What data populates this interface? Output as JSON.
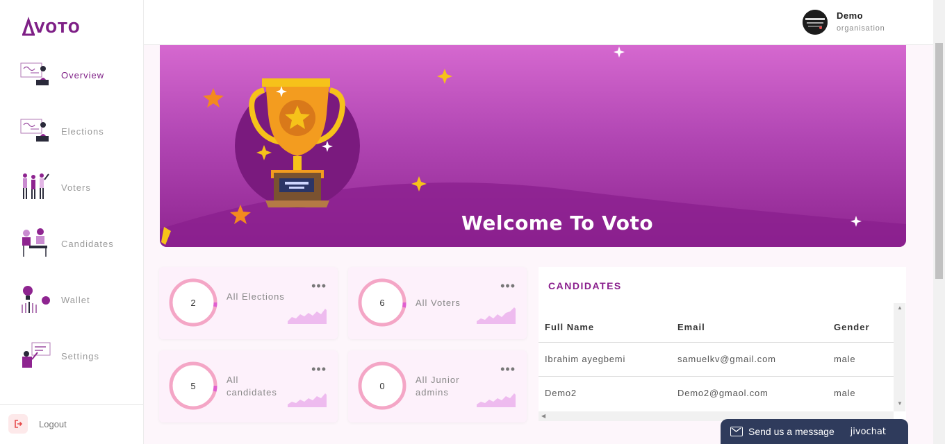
{
  "app": {
    "logo_text": "VOTO"
  },
  "sidebar": {
    "items": [
      {
        "label": "Overview",
        "icon": "presentation-icon",
        "active": true
      },
      {
        "label": "Elections",
        "icon": "presentation-icon",
        "active": false
      },
      {
        "label": "Voters",
        "icon": "people-group-icon",
        "active": false
      },
      {
        "label": "Candidates",
        "icon": "meeting-icon",
        "active": false
      },
      {
        "label": "Wallet",
        "icon": "wallet-bulb-icon",
        "active": false
      },
      {
        "label": "Settings",
        "icon": "settings-presenter-icon",
        "active": false
      }
    ],
    "logout_label": "Logout"
  },
  "header": {
    "user_name": "Demo",
    "user_role": "organisation"
  },
  "banner": {
    "title": "Welcome To Voto"
  },
  "stats": [
    {
      "value": "2",
      "label": "All Elections"
    },
    {
      "value": "6",
      "label": "All Voters"
    },
    {
      "value": "5",
      "label": "All candidates"
    },
    {
      "value": "0",
      "label": "All Junior admins"
    }
  ],
  "candidates": {
    "title": "CANDIDATES",
    "columns": [
      "Full Name",
      "Email",
      "Gender"
    ],
    "rows": [
      [
        "Ibrahim ayegbemi",
        "samuelkv@gmail.com",
        "male"
      ],
      [
        "Demo2",
        "Demo2@gmaol.com",
        "male"
      ]
    ]
  },
  "chat": {
    "label": "Send us a message",
    "brand": "jivochat"
  },
  "colors": {
    "accent": "#7e1f86",
    "banner_top": "#d568cf",
    "banner_bottom": "#8e2490",
    "ring": "#f4a6c6",
    "chat_bg": "#2f3b5c"
  }
}
